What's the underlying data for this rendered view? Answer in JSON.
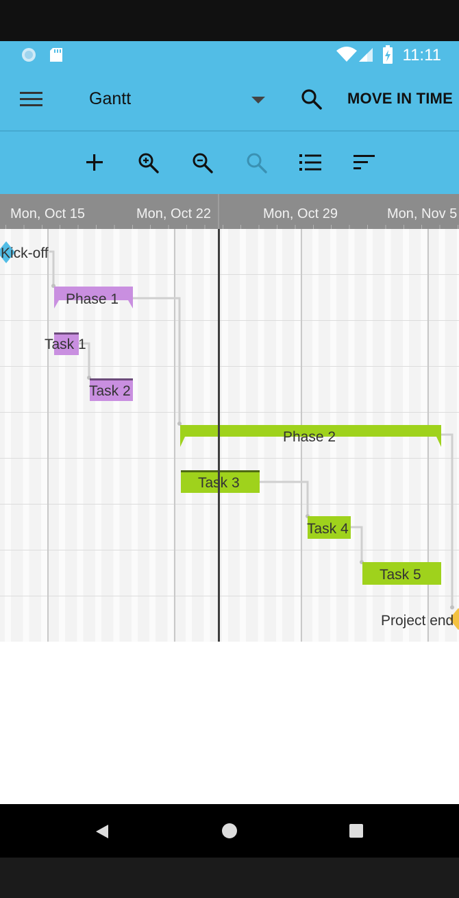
{
  "status_bar": {
    "time": "11:11"
  },
  "app_bar": {
    "title": "Gantt",
    "action": "MOVE IN TIME"
  },
  "toolbar": {
    "icons": [
      "add-icon",
      "zoom-in-icon",
      "zoom-out-icon",
      "zoom-reset-icon",
      "list-icon",
      "sort-icon"
    ]
  },
  "timeline": {
    "ticks": [
      "Mon, Oct 15",
      "Mon, Oct 22",
      "Mon, Oct 29",
      "Mon, Nov 5"
    ]
  },
  "tasks": [
    {
      "name": "Kick-off",
      "type": "milestone",
      "color": "#52bde6"
    },
    {
      "name": "Phase 1",
      "type": "summary",
      "color": "#c98fe0"
    },
    {
      "name": "Task 1",
      "type": "task",
      "color": "#c98fe0"
    },
    {
      "name": "Task 2",
      "type": "task",
      "color": "#c98fe0"
    },
    {
      "name": "Phase 2",
      "type": "summary",
      "color": "#9fd21c"
    },
    {
      "name": "Task 3",
      "type": "task",
      "color": "#9fd21c"
    },
    {
      "name": "Task 4",
      "type": "task",
      "color": "#9fd21c"
    },
    {
      "name": "Task 5",
      "type": "task",
      "color": "#9fd21c"
    },
    {
      "name": "Project end",
      "type": "milestone",
      "color": "#f4c241"
    }
  ]
}
